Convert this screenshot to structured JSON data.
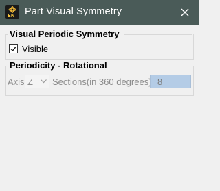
{
  "window": {
    "title": "Part Visual Symmetry",
    "app_icon_text": "EN",
    "title_bar_color": "#4a5b58"
  },
  "visual_periodic_symmetry": {
    "legend": "Visual Periodic Symmetry",
    "visible_label": "Visible",
    "visible_checked": true
  },
  "periodicity": {
    "legend": "Periodicity - Rotational",
    "axis_label": "Axis",
    "axis_value": "Z",
    "sections_label": "Sections(in 360 degrees)",
    "sections_value": "8",
    "sections_field_color": "#b4cce6"
  },
  "icons": {
    "close": "close-icon",
    "app": "app-logo-icon",
    "check": "checkmark-icon",
    "dropdown": "chevron-down-icon"
  }
}
